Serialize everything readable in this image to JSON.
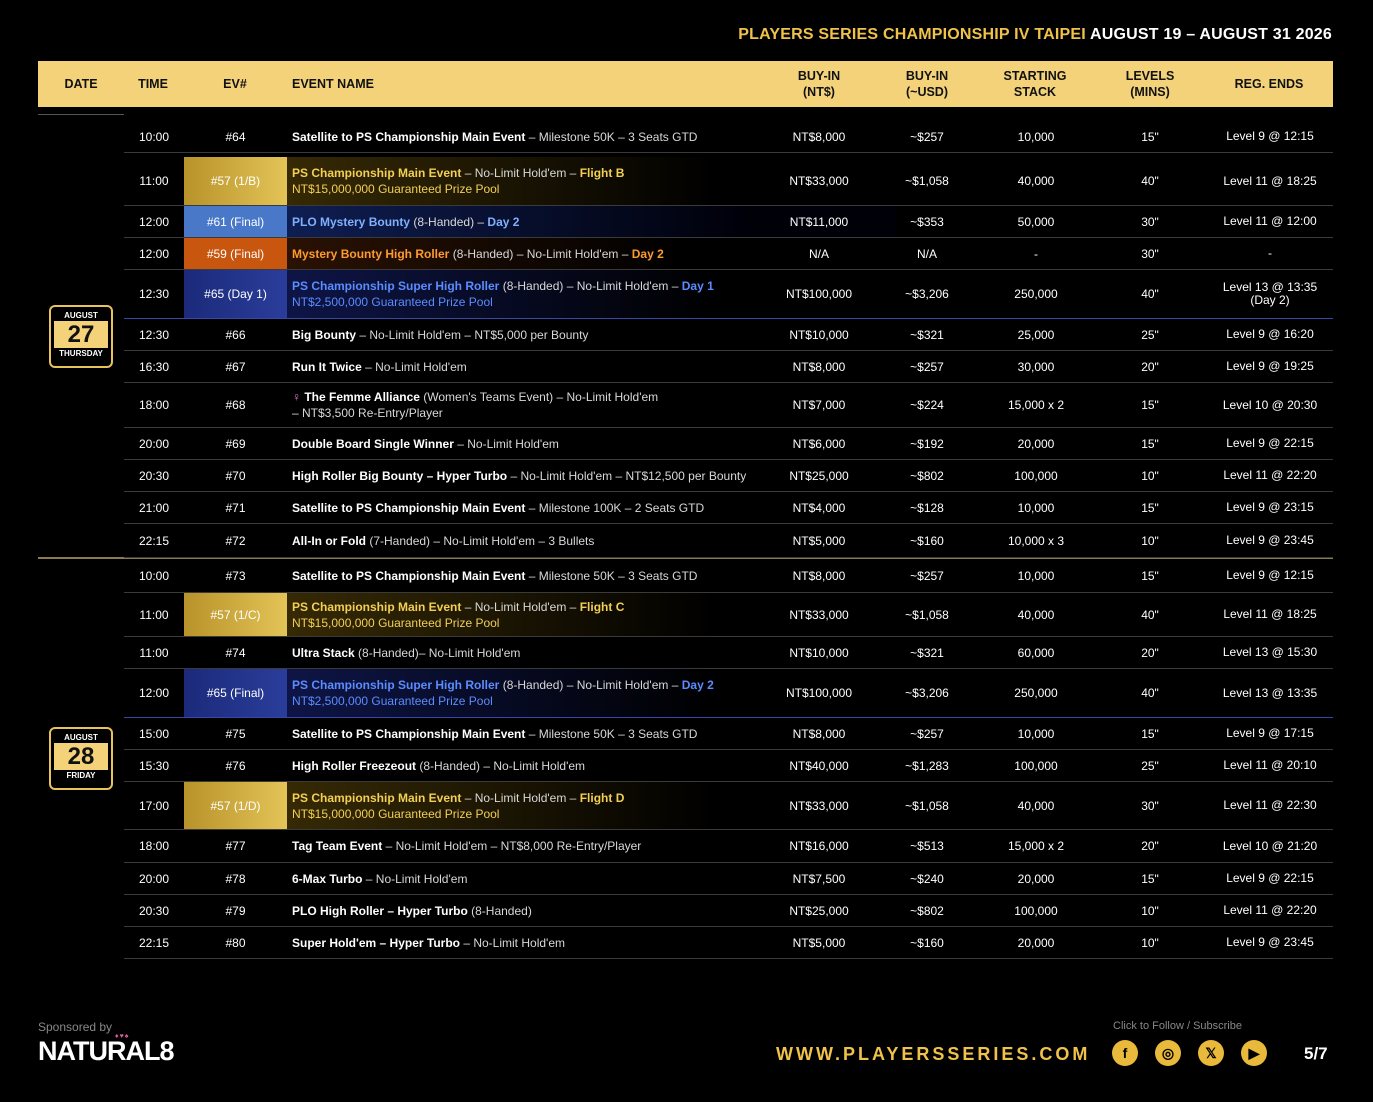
{
  "title": {
    "part1": "PLAYERS SERIES CHAMPIONSHIP IV TAIPEI",
    "part2": "AUGUST 19 – AUGUST 31 2026"
  },
  "header": {
    "date": "DATE",
    "time": "TIME",
    "ev": "EV#",
    "name": "EVENT NAME",
    "buyin1": "BUY-IN",
    "buyin2": "(NT$)",
    "usd1": "BUY-IN",
    "usd2": "(~USD)",
    "stack1": "STARTING",
    "stack2": "STACK",
    "levels1": "LEVELS",
    "levels2": "(MINS)",
    "reg": "REG. ENDS"
  },
  "dates": [
    {
      "month": "AUGUST",
      "day": "27",
      "dow": "THURSDAY"
    },
    {
      "month": "AUGUST",
      "day": "28",
      "dow": "FRIDAY"
    }
  ],
  "rows": [
    {
      "time": "10:00",
      "ev": "#64",
      "name_bold": "Satellite to PS Championship Main Event",
      "name_rest": " – Milestone 50K – 3 Seats GTD",
      "buyin": "NT$8,000",
      "usd": "~$257",
      "stack": "10,000",
      "levels": "15\"",
      "reg": "Level 9 @ 12:15"
    },
    {
      "time": "11:00",
      "ev": "#57 (1/B)",
      "name_bold": "PS Championship Main Event",
      "name_rest": " – No-Limit Hold'em – ",
      "name_hl": "Flight B",
      "name_line2": "NT$15,000,000 Guaranteed Prize Pool",
      "buyin": "NT$33,000",
      "usd": "~$1,058",
      "stack": "40,000",
      "levels": "40\"",
      "reg": "Level 11 @ 18:25"
    },
    {
      "time": "12:00",
      "ev": "#61 (Final)",
      "name_bold": "PLO Mystery Bounty",
      "name_rest": " (8-Handed) – ",
      "name_hl": "Day 2",
      "buyin": "NT$11,000",
      "usd": "~$353",
      "stack": "50,000",
      "levels": "30\"",
      "reg": "Level 11 @ 12:00"
    },
    {
      "time": "12:00",
      "ev": "#59 (Final)",
      "name_bold": "Mystery Bounty High Roller",
      "name_rest": " (8-Handed) – No-Limit Hold'em – ",
      "name_hl": "Day 2",
      "buyin": "N/A",
      "usd": "N/A",
      "stack": "-",
      "levels": "30\"",
      "reg": "-"
    },
    {
      "time": "12:30",
      "ev": "#65 (Day 1)",
      "name_bold": "PS Championship Super High Roller",
      "name_rest": " (8-Handed) – No-Limit Hold'em – ",
      "name_hl": "Day 1",
      "name_line2": "NT$2,500,000 Guaranteed Prize Pool",
      "buyin": "NT$100,000",
      "usd": "~$3,206",
      "stack": "250,000",
      "levels": "40\"",
      "reg": "Level 13 @ 13:35",
      "reg2": "(Day 2)"
    },
    {
      "time": "12:30",
      "ev": "#66",
      "name_bold": "Big Bounty",
      "name_rest": " – No-Limit Hold'em – NT$5,000 per Bounty",
      "buyin": "NT$10,000",
      "usd": "~$321",
      "stack": "25,000",
      "levels": "25\"",
      "reg": "Level 9 @ 16:20"
    },
    {
      "time": "16:30",
      "ev": "#67",
      "name_bold": "Run It Twice",
      "name_rest": " – No-Limit Hold'em",
      "buyin": "NT$8,000",
      "usd": "~$257",
      "stack": "30,000",
      "levels": "20\"",
      "reg": "Level 9 @ 19:25"
    },
    {
      "time": "18:00",
      "ev": "#68",
      "name_icon": "♀",
      "name_bold": "The Femme Alliance",
      "name_rest": " (Women's Teams Event) – No-Limit Hold'em",
      "name_line2": "– NT$3,500 Re-Entry/Player",
      "buyin": "NT$7,000",
      "usd": "~$224",
      "stack": "15,000 x 2",
      "levels": "15\"",
      "reg": "Level 10 @ 20:30"
    },
    {
      "time": "20:00",
      "ev": "#69",
      "name_bold": "Double Board Single Winner",
      "name_rest": " – No-Limit Hold'em",
      "buyin": "NT$6,000",
      "usd": "~$192",
      "stack": "20,000",
      "levels": "15\"",
      "reg": "Level 9 @ 22:15"
    },
    {
      "time": "20:30",
      "ev": "#70",
      "name_bold": "High Roller Big Bounty – Hyper Turbo",
      "name_rest": " – No-Limit Hold'em – NT$12,500 per Bounty",
      "buyin": "NT$25,000",
      "usd": "~$802",
      "stack": "100,000",
      "levels": "10\"",
      "reg": "Level 11 @ 22:20"
    },
    {
      "time": "21:00",
      "ev": "#71",
      "name_bold": "Satellite to PS Championship Main Event",
      "name_rest": " – Milestone 100K – 2 Seats GTD",
      "buyin": "NT$4,000",
      "usd": "~$128",
      "stack": "10,000",
      "levels": "15\"",
      "reg": "Level 9 @ 23:15"
    },
    {
      "time": "22:15",
      "ev": "#72",
      "name_bold": "All-In or Fold",
      "name_rest": " (7-Handed) – No-Limit Hold'em – 3 Bullets",
      "buyin": "NT$5,000",
      "usd": "~$160",
      "stack": "10,000 x 3",
      "levels": "10\"",
      "reg": "Level 9 @ 23:45"
    },
    {
      "time": "10:00",
      "ev": "#73",
      "name_bold": "Satellite to PS Championship Main Event",
      "name_rest": " – Milestone 50K – 3 Seats GTD",
      "buyin": "NT$8,000",
      "usd": "~$257",
      "stack": "10,000",
      "levels": "15\"",
      "reg": "Level 9 @ 12:15"
    },
    {
      "time": "11:00",
      "ev": "#57 (1/C)",
      "name_bold": "PS Championship Main Event",
      "name_rest": " – No-Limit Hold'em – ",
      "name_hl": "Flight C",
      "name_line2": "NT$15,000,000 Guaranteed Prize Pool",
      "buyin": "NT$33,000",
      "usd": "~$1,058",
      "stack": "40,000",
      "levels": "40\"",
      "reg": "Level 11 @ 18:25"
    },
    {
      "time": "11:00",
      "ev": "#74",
      "name_bold": "Ultra Stack",
      "name_rest": " (8-Handed)– No-Limit Hold'em",
      "buyin": "NT$10,000",
      "usd": "~$321",
      "stack": "60,000",
      "levels": "20\"",
      "reg": "Level 13 @ 15:30"
    },
    {
      "time": "12:00",
      "ev": "#65 (Final)",
      "name_bold": "PS Championship Super High Roller",
      "name_rest": " (8-Handed) – No-Limit Hold'em – ",
      "name_hl": "Day 2",
      "name_line2": "NT$2,500,000 Guaranteed Prize Pool",
      "buyin": "NT$100,000",
      "usd": "~$3,206",
      "stack": "250,000",
      "levels": "40\"",
      "reg": "Level 13 @ 13:35"
    },
    {
      "time": "15:00",
      "ev": "#75",
      "name_bold": "Satellite to PS Championship Main Event",
      "name_rest": " – Milestone 50K – 3 Seats GTD",
      "buyin": "NT$8,000",
      "usd": "~$257",
      "stack": "10,000",
      "levels": "15\"",
      "reg": "Level 9 @ 17:15"
    },
    {
      "time": "15:30",
      "ev": "#76",
      "name_bold": "High Roller Freezeout",
      "name_rest": " (8-Handed) – No-Limit Hold'em",
      "buyin": "NT$40,000",
      "usd": "~$1,283",
      "stack": "100,000",
      "levels": "25\"",
      "reg": "Level 11 @ 20:10"
    },
    {
      "time": "17:00",
      "ev": "#57 (1/D)",
      "name_bold": "PS Championship Main Event",
      "name_rest": " – No-Limit Hold'em – ",
      "name_hl": "Flight D",
      "name_line2": "NT$15,000,000 Guaranteed Prize Pool",
      "buyin": "NT$33,000",
      "usd": "~$1,058",
      "stack": "40,000",
      "levels": "30\"",
      "reg": "Level 11 @ 22:30"
    },
    {
      "time": "18:00",
      "ev": "#77",
      "name_bold": "Tag Team Event",
      "name_rest": " – No-Limit Hold'em – NT$8,000 Re-Entry/Player",
      "buyin": "NT$16,000",
      "usd": "~$513",
      "stack": "15,000 x 2",
      "levels": "20\"",
      "reg": "Level 10 @ 21:20"
    },
    {
      "time": "20:00",
      "ev": "#78",
      "name_bold": "6-Max Turbo",
      "name_rest": " – No-Limit Hold'em",
      "buyin": "NT$7,500",
      "usd": "~$240",
      "stack": "20,000",
      "levels": "15\"",
      "reg": "Level 9 @ 22:15"
    },
    {
      "time": "20:30",
      "ev": "#79",
      "name_bold": "PLO High Roller – Hyper Turbo",
      "name_rest": " (8-Handed)",
      "buyin": "NT$25,000",
      "usd": "~$802",
      "stack": "100,000",
      "levels": "10\"",
      "reg": "Level 11 @ 22:20"
    },
    {
      "time": "22:15",
      "ev": "#80",
      "name_bold": "Super Hold'em – Hyper Turbo",
      "name_rest": " – No-Limit Hold'em",
      "buyin": "NT$5,000",
      "usd": "~$160",
      "stack": "20,000",
      "levels": "10\"",
      "reg": "Level 9 @ 23:45"
    }
  ],
  "footer": {
    "sponsored": "Sponsored by",
    "logo": "NATURAL8",
    "logo_dots": "♦♥♠",
    "url": "WWW.PLAYERSSERIES.COM",
    "follow": "Click to Follow / Subscribe",
    "social": [
      {
        "icon": "facebook-icon",
        "glyph": "f"
      },
      {
        "icon": "instagram-icon",
        "glyph": "◎"
      },
      {
        "icon": "x-icon",
        "glyph": "𝕏"
      },
      {
        "icon": "youtube-icon",
        "glyph": "▶"
      }
    ],
    "page": "5/7"
  },
  "colors": {
    "gold": "#f3d27a",
    "blue_band": "#1e2f8a",
    "lightblue_band": "#4a78c8",
    "orange_band": "#c8560e"
  }
}
